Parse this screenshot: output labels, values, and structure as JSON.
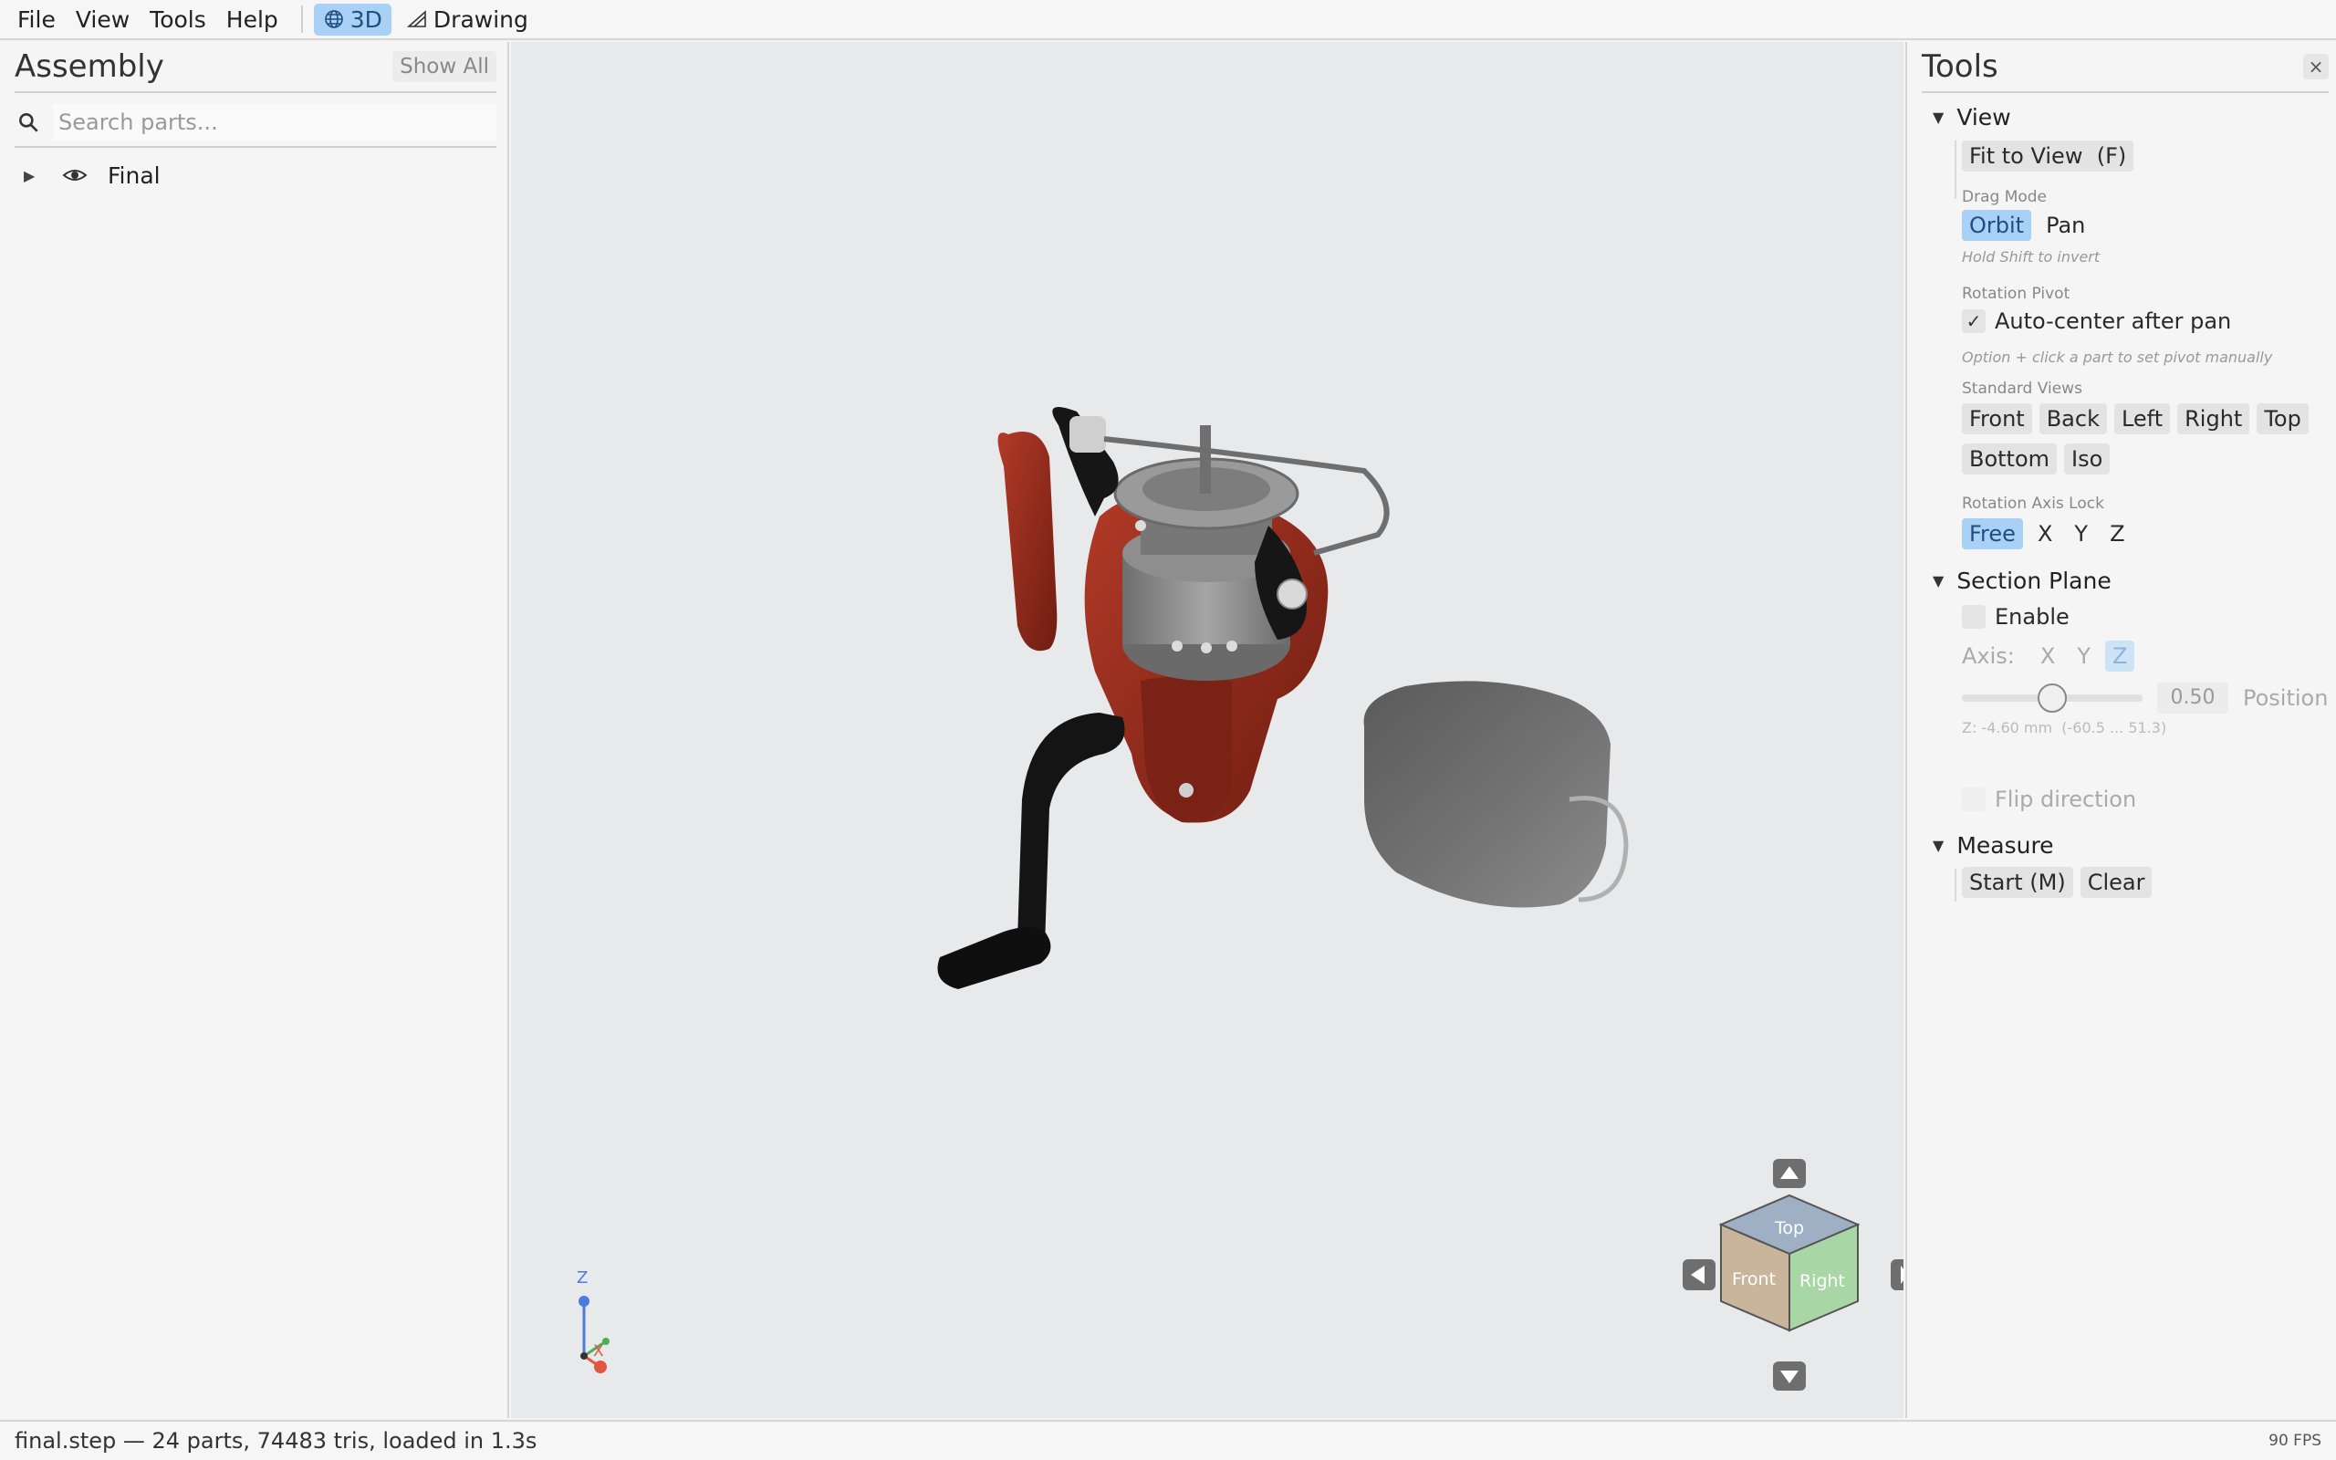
{
  "menubar": {
    "items": [
      "File",
      "View",
      "Tools",
      "Help"
    ],
    "modes": [
      {
        "label": "3D",
        "icon": "globe-icon",
        "active": true
      },
      {
        "label": "Drawing",
        "icon": "drafting-icon",
        "active": false
      }
    ]
  },
  "assembly": {
    "title": "Assembly",
    "show_all_label": "Show All",
    "search_placeholder": "Search parts...",
    "tree": [
      {
        "label": "Final",
        "expanded": false,
        "visible": true
      }
    ]
  },
  "viewport": {
    "axis_labels": {
      "z": "Z",
      "x": "X"
    },
    "navcube": {
      "top": "Top",
      "front": "Front",
      "right": "Right"
    }
  },
  "tools": {
    "title": "Tools",
    "close_label": "×",
    "view": {
      "title": "View",
      "fit_label": "Fit to View  (F)",
      "drag_mode_label": "Drag Mode",
      "drag_modes": [
        "Orbit",
        "Pan"
      ],
      "drag_hint": "Hold Shift to invert",
      "rotation_pivot_label": "Rotation Pivot",
      "auto_center_label": "Auto-center after pan",
      "auto_center_checked": true,
      "pivot_hint": "Option + click a part to set pivot manually",
      "standard_views_label": "Standard Views",
      "standard_views_row1": [
        "Front",
        "Back",
        "Left",
        "Right",
        "Top"
      ],
      "standard_views_row2": [
        "Bottom",
        "Iso"
      ],
      "axis_lock_label": "Rotation Axis Lock",
      "axis_lock_options": [
        "Free",
        "X",
        "Y",
        "Z"
      ]
    },
    "section": {
      "title": "Section Plane",
      "enable_label": "Enable",
      "axis_label": "Axis:",
      "axis_options": [
        "X",
        "Y",
        "Z"
      ],
      "slider_value": "0.50",
      "slider_fraction": 0.5,
      "position_label": "Position",
      "range_text": "Z: -4.60 mm  (-60.5 ... 51.3)",
      "flip_label": "Flip direction"
    },
    "measure": {
      "title": "Measure",
      "start_label": "Start (M)",
      "clear_label": "Clear"
    }
  },
  "status": {
    "text": "final.step — 24 parts, 74483 tris, loaded in 1.3s",
    "fps": "90 FPS"
  },
  "colors": {
    "accent": "#a9d0f5",
    "accent_text": "#1f4e83",
    "reel_red": "#8e2a1c",
    "reel_black": "#151515",
    "spool_gray": "#8a8a8a",
    "cube_top": "#9fb0c4",
    "cube_front": "#c9b49c",
    "cube_right": "#a8d6a4"
  }
}
